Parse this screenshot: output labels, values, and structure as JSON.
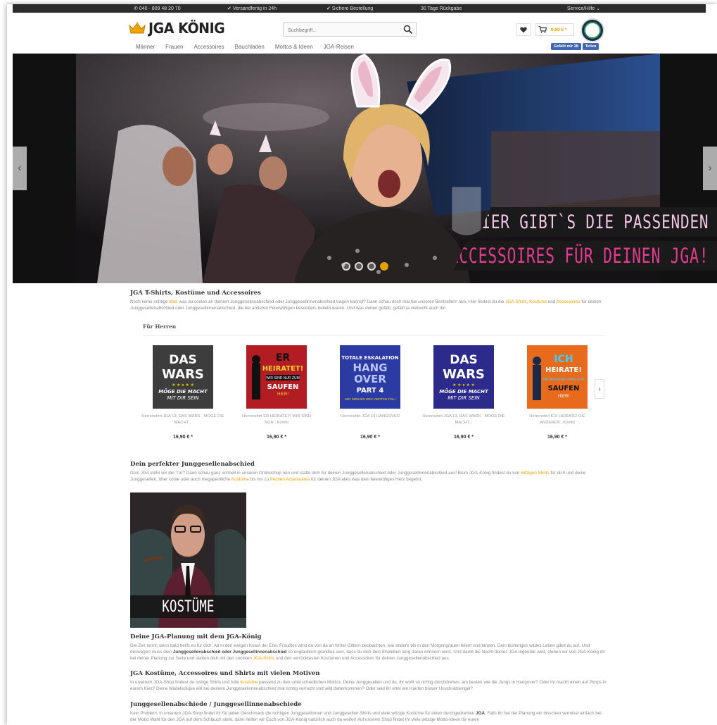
{
  "topbar": {
    "phone": "✆ 040 - 809 48 20 70",
    "shipping": "✔ Versandfertig in 24h",
    "secure": "✔ Sichere Bestellung",
    "days": "30 Tage Rückgabe",
    "service": "Service/Hilfe ⌄"
  },
  "header": {
    "logo_text": "JGA KÖNIG",
    "search_placeholder": "Suchbegriff...",
    "cart_amount": "0,00 € *"
  },
  "nav": {
    "items": [
      "Männer",
      "Frauen",
      "Accessoires",
      "Bauchladen",
      "Mottos & Ideen",
      "JGA-Reisen"
    ]
  },
  "facebook": {
    "like": "Gefällt mir 38",
    "share": "Teilen"
  },
  "hero": {
    "line1": "HIER GIBT`S DIE PASSENDEN",
    "line2": "ACCESSOIRES FÜR DEINEN JGA!",
    "line1_color": "#f3c6e8",
    "line2_color": "#e23b8f"
  },
  "intro": {
    "title": "JGA T-Shirts, Kostüme und Accessoires",
    "text_a": "Noch keine richtige ",
    "link_a": "Idee",
    "text_b": " was du cooles an deinem Junggesellenabschied oder Junggesellinnenabschied tragen kannst? Dann schau doch mal bei unseren Bestsellern rein. Hier findest du die ",
    "link_b": "JGA-Shirts",
    "sep1": ", ",
    "link_c": "Kostüme",
    "text_c": " und ",
    "link_d": "Accessoires",
    "text_d": " für deinen Junggesellenabschied oder Junggesellinnenabschied, die bei anderen Feierwütigen besonders beliebt waren. Und was denen gefällt, gefällt ja vielleicht auch dir!"
  },
  "slider": {
    "title": "Für Herren",
    "products": [
      {
        "name": "Herrenshirt JGA 13, DAS WARS - MÖGE DIE MACHT...",
        "price": "16,90 € *",
        "art": "DAS WARS"
      },
      {
        "name": "Herrenshirt ER HEIRATET! WIR SIND NUR...Kombi",
        "price": "16,90 € *",
        "art": "ER HEIRATET!"
      },
      {
        "name": "Herrenshirt JGA 19 HANGOVER",
        "price": "16,90 € *",
        "art": "HANG OVER"
      },
      {
        "name": "Herrenshirt JGA 13, DAS WARS - MÖGE DIE MACHT...",
        "price": "16,90 € *",
        "art": "DAS WARS"
      },
      {
        "name": "Herrenshirt ICH HEIRATE! DIE ANDEREN...Kombi",
        "price": "16,90 € *",
        "art": "ICH HEIRATE!"
      }
    ]
  },
  "perfect": {
    "title": "Dein perfekter Junggesellenabschied",
    "text_a": "Dein JGA steht vor der Tür? Dann schau ganz schnell in unseren Onlineshop rein und statte dich für deinen Junggesellenabschied oder Junggesellinnenabschied aus! Beim JGA-König findest du von ",
    "link_a": "witzigen Shirts",
    "text_b": " für dich und deine Junggesellen, über coole oder auch megapeinliche ",
    "link_b": "Kostüme",
    "text_c": " bis hin zu ",
    "link_c": "frechen Accessoires",
    "text_d": " für deinen JGA alles was dein feierwütiges Herz begehrt."
  },
  "kostueme": {
    "label": "KOSTÜME"
  },
  "planning": {
    "title": "Deine JGA-Planung mit dem JGA-König",
    "text_a": "Die Zeit rennt, denn bald heißt es für dich: Ab in den ewigen Knast der Ehe. Freudlos wirst du von da an hinter Gittern beobachten, wie andere bis in den Morgengrauen feiern und tanzen. Dein bisheriges wildes Leben gibst du auf. Und deswegen muss dein ",
    "bold_a": "Junggesellenabschied oder Junggesellinnenabschied",
    "text_b": " so unglaublich grandios sein, dass du dich dein Eheleben lang daran erinnern wirst. Und damit die Nacht deines JGA legendär wird, stehen wir von JGA-König dir bei deiner Planung zur Seite und statten dich mit den coolsten ",
    "link_a": "JGA-Shirts",
    "text_c": " und den verrücktesten Kostümen und Accessoires für deinen Junggesellenabschied aus."
  },
  "costumes": {
    "title": "JGA Kostüme, Accessoires und Shirts mit vielen Motiven",
    "text_a": "In unserem JGA-Shop findest du lustige Shirts und tolle ",
    "link_a": "Kostüme",
    "text_b": " passend zu den unterschiedlichen Mottos. Deine Junggesellen und du, ihr wollt so richtig durchdrehen, am besten wie die Jungs in Hangover? Oder ihr macht einen auf Pimps in eurem Kiez? Deine Mädelsclique will bei deinem Junggesellinnenabschied mal richtig verrucht und wild daherkommen? Oder seid ihr eher ein Haufen braver Unschuldsengel?"
  },
  "bachelor": {
    "title": "Junggesellenabschiede / Junggesellinnenabschiede",
    "text_a": "Kein Problem, in unserem JGA-Shop findet ihr für jeden Geschmack die richtigen Junggesellinnen und Junggesellen-Shirts und viele witzige Kostüme für einen durchgedrehten ",
    "bold_a": "JGA",
    "text_b": ". Falls ihr bei der Planung ein bisschen vermisst einfach bei der Motto Wahl für den JGA auf dem Schlauch steht, dann helfen wir Euch von JGA-König natürlich auch da weiter! Auf unserer Shop findet Ihr viele witzige Motto-Ideen für euren"
  },
  "colors": {
    "accent": "#e8a000",
    "facebook": "#4267b2"
  }
}
